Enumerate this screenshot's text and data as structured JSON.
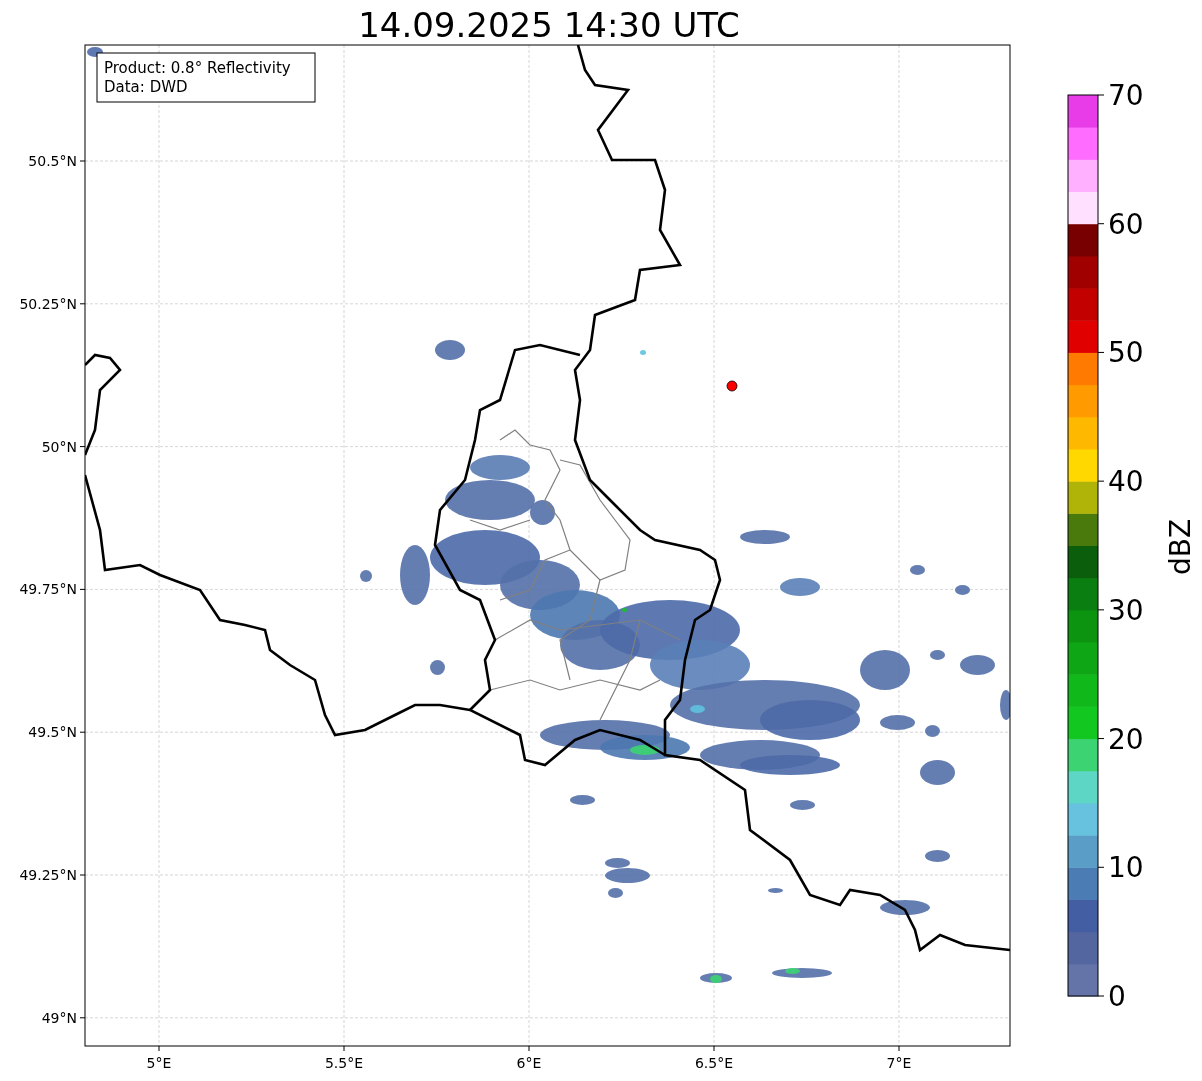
{
  "title": "14.09.2025 14:30 UTC",
  "info_box": {
    "lines": [
      "Product: 0.8° Reflectivity",
      "Data: DWD"
    ]
  },
  "map": {
    "xticks": [
      "5°E",
      "5.5°E",
      "6°E",
      "6.5°E",
      "7°E"
    ],
    "yticks": [
      "50.5°N",
      "50.25°N",
      "50°N",
      "49.75°N",
      "49.5°N",
      "49.25°N",
      "49°N"
    ]
  },
  "colorbar": {
    "label": "dBZ",
    "ticks": [
      "70",
      "60",
      "50",
      "40",
      "30",
      "20",
      "10",
      "0"
    ],
    "bins": [
      {
        "color": "#6474a8"
      },
      {
        "color": "#5466a0"
      },
      {
        "color": "#445ea4"
      },
      {
        "color": "#4c7cb4"
      },
      {
        "color": "#5a9ec8"
      },
      {
        "color": "#66c2de"
      },
      {
        "color": "#5ed6c6"
      },
      {
        "color": "#3cd472"
      },
      {
        "color": "#12c820"
      },
      {
        "color": "#10b81a"
      },
      {
        "color": "#0ea614"
      },
      {
        "color": "#0c9410"
      },
      {
        "color": "#0a7e10"
      },
      {
        "color": "#0a5e0c"
      },
      {
        "color": "#4a7a0c"
      },
      {
        "color": "#b0b408"
      },
      {
        "color": "#ffd800"
      },
      {
        "color": "#ffb800"
      },
      {
        "color": "#ff9a00"
      },
      {
        "color": "#ff7a00"
      },
      {
        "color": "#e00000"
      },
      {
        "color": "#c20000"
      },
      {
        "color": "#a00000"
      },
      {
        "color": "#780000"
      },
      {
        "color": "#ffe0ff"
      },
      {
        "color": "#ffb0ff"
      },
      {
        "color": "#ff6cff"
      },
      {
        "color": "#e83ce8"
      }
    ]
  }
}
